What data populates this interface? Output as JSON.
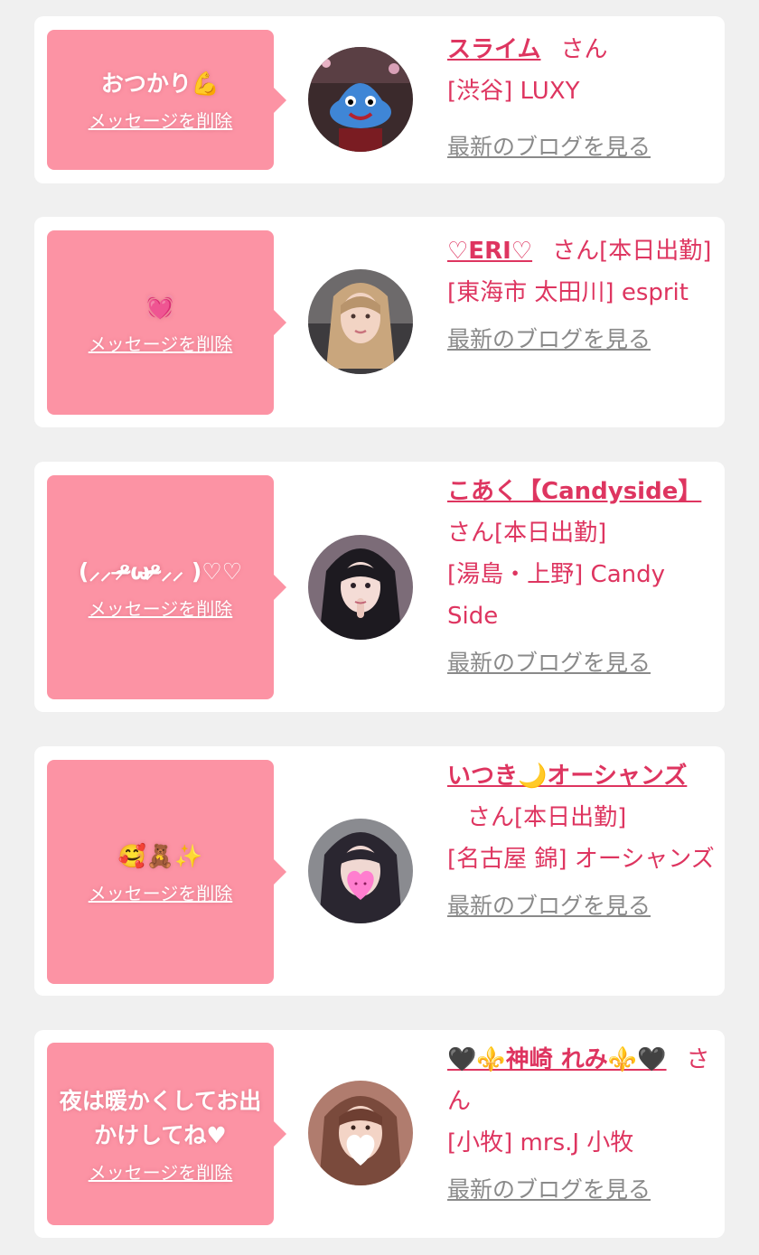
{
  "entries": [
    {
      "message": "おつかり💪",
      "delete_label": "メッセージを削除",
      "name": "スライム",
      "suffix": "さん",
      "shop": "[渋谷] LUXY",
      "blog_label": "最新のブログを見る",
      "avatar": "slime-toy-avatar"
    },
    {
      "message": "💓",
      "delete_label": "メッセージを削除",
      "name": "♡ERI♡",
      "suffix": "さん[本日出勤]",
      "shop": "[東海市 太田川] esprit",
      "blog_label": "最新のブログを見る",
      "avatar": "woman-blonde-avatar"
    },
    {
      "message": "(⸝⸝ ᵒ̴̶̷ωᵒ̴̶̷⸝⸝ )♡♡",
      "delete_label": "メッセージを削除",
      "name": "こあく【Candyside】",
      "suffix": "さん[本日出勤]",
      "shop": "[湯島・上野] Candy Side",
      "blog_label": "最新のブログを見る",
      "avatar": "woman-dark-hair-avatar"
    },
    {
      "message": "🥰🧸✨",
      "delete_label": "メッセージを削除",
      "name": "いつき🌙オーシャンズ",
      "suffix": "さん[本日出勤]",
      "shop": "[名古屋 錦] オーシャンズ",
      "blog_label": "最新のブログを見る",
      "avatar": "woman-heart-face-avatar"
    },
    {
      "message": "夜は暖かくしてお出かけしてね♥",
      "delete_label": "メッセージを削除",
      "name": "🖤⚜️神崎 れみ⚜️🖤",
      "suffix": "さん",
      "shop": "[小牧] mrs.J 小牧",
      "blog_label": "最新のブログを見る",
      "avatar": "woman-white-heart-avatar"
    }
  ],
  "colors": {
    "background": "#f0f0f0",
    "bubble": "#fc93a4",
    "accent": "#de3560",
    "link_gray": "#8a8a8a"
  }
}
